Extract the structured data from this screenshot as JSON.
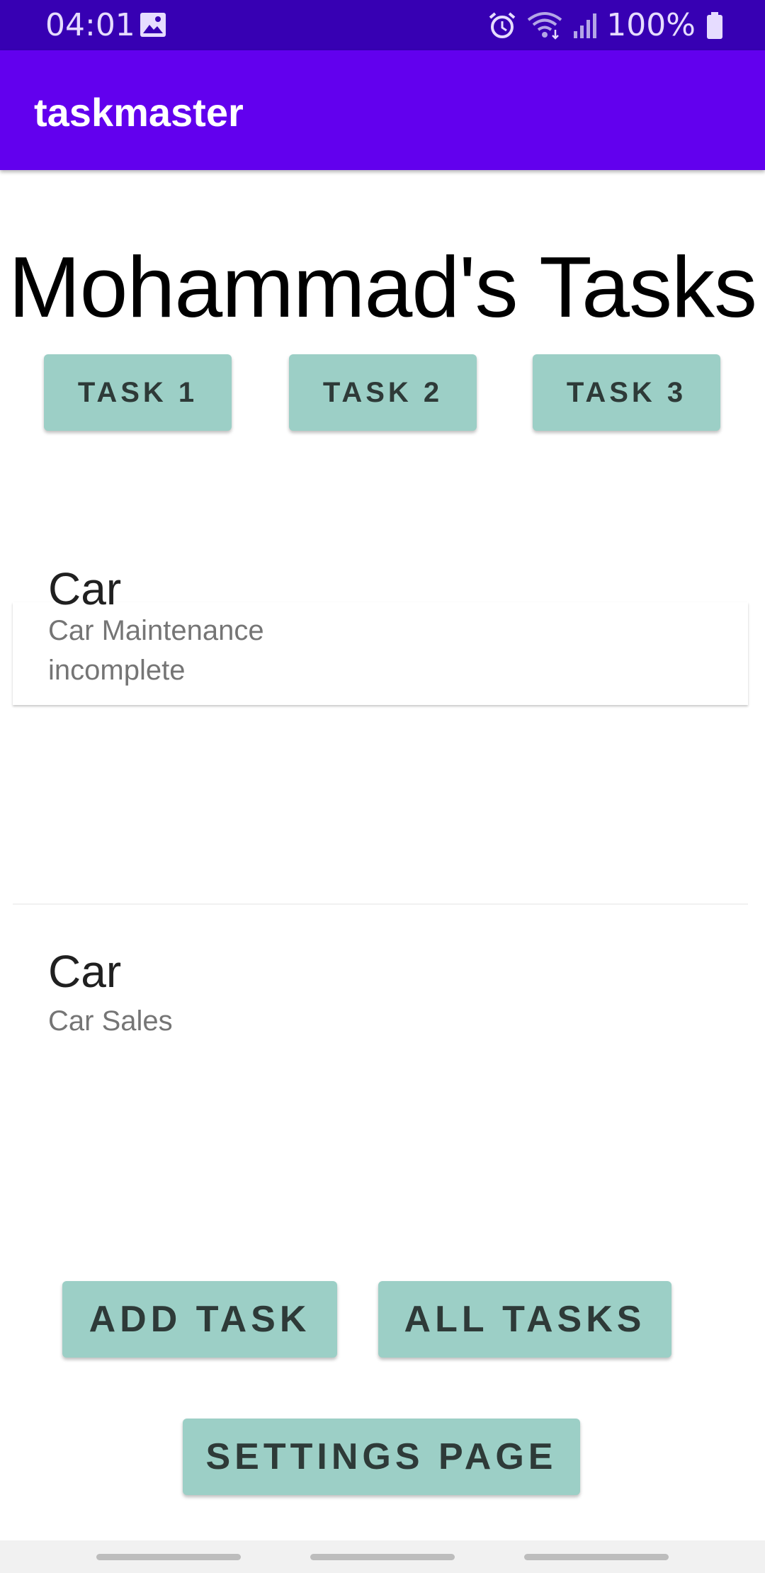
{
  "status_bar": {
    "time": "04:01",
    "battery": "100%"
  },
  "app_bar": {
    "title": "taskmaster"
  },
  "heading": "Mohammad's Tasks",
  "task_buttons": [
    "Task 1",
    "Task 2",
    "Task 3"
  ],
  "tasks": [
    {
      "title": "Car",
      "body": "Car Maintenance",
      "state": "incomplete"
    },
    {
      "title": "Car",
      "body": "Car Sales"
    }
  ],
  "actions": {
    "add_task": "Add Task",
    "all_tasks": "All Tasks",
    "settings": "Settings Page"
  },
  "colors": {
    "primary": "#6200ee",
    "primary_dark": "#3700b3",
    "button": "#9ccfc6"
  }
}
